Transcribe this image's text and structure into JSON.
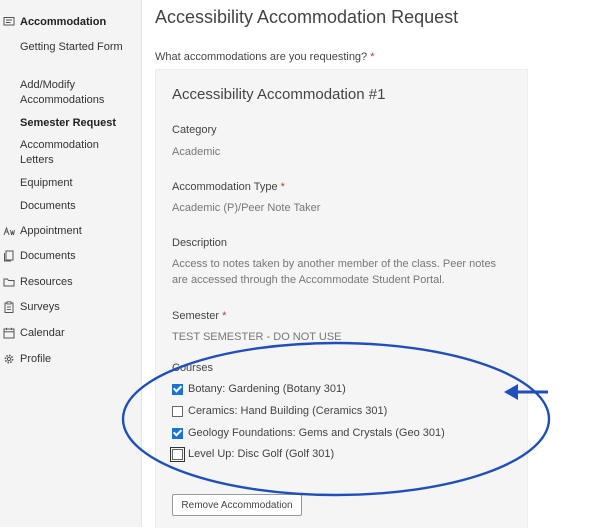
{
  "sidebar": {
    "accommodation": "Accommodation",
    "sub_items": [
      "Getting Started Form",
      "Add/Modify Accommodations",
      "Semester Request",
      "Accommodation Letters",
      "Equipment",
      "Documents"
    ],
    "appointment": "Appointment",
    "documents": "Documents",
    "resources": "Resources",
    "surveys": "Surveys",
    "calendar": "Calendar",
    "profile": "Profile"
  },
  "main": {
    "title": "Accessibility Accommodation Request",
    "question": "What accommodations are you requesting?",
    "required_mark": "*",
    "card": {
      "title": "Accessibility Accommodation #1",
      "category_label": "Category",
      "category_value": "Academic",
      "type_label": "Accommodation Type",
      "type_value": "Academic (P)/Peer Note Taker",
      "description_label": "Description",
      "description_value": "Access to notes taken by another member of the class. Peer notes are accessed through the Accommodate Student Portal.",
      "semester_label": "Semester",
      "semester_value": "TEST SEMESTER - DO NOT USE",
      "courses_label": "Courses",
      "courses": [
        {
          "label": "Botany: Gardening (Botany 301)",
          "checked": true
        },
        {
          "label": "Ceramics: Hand Building (Ceramics 301)",
          "checked": false
        },
        {
          "label": "Geology Foundations: Gems and Crystals (Geo 301)",
          "checked": true
        },
        {
          "label": "Level Up: Disc Golf (Golf 301)",
          "checked": false
        }
      ],
      "remove_button": "Remove Accommodation"
    }
  },
  "colors": {
    "annotation": "#1f4fbf",
    "checkbox": "#1a73d9"
  }
}
